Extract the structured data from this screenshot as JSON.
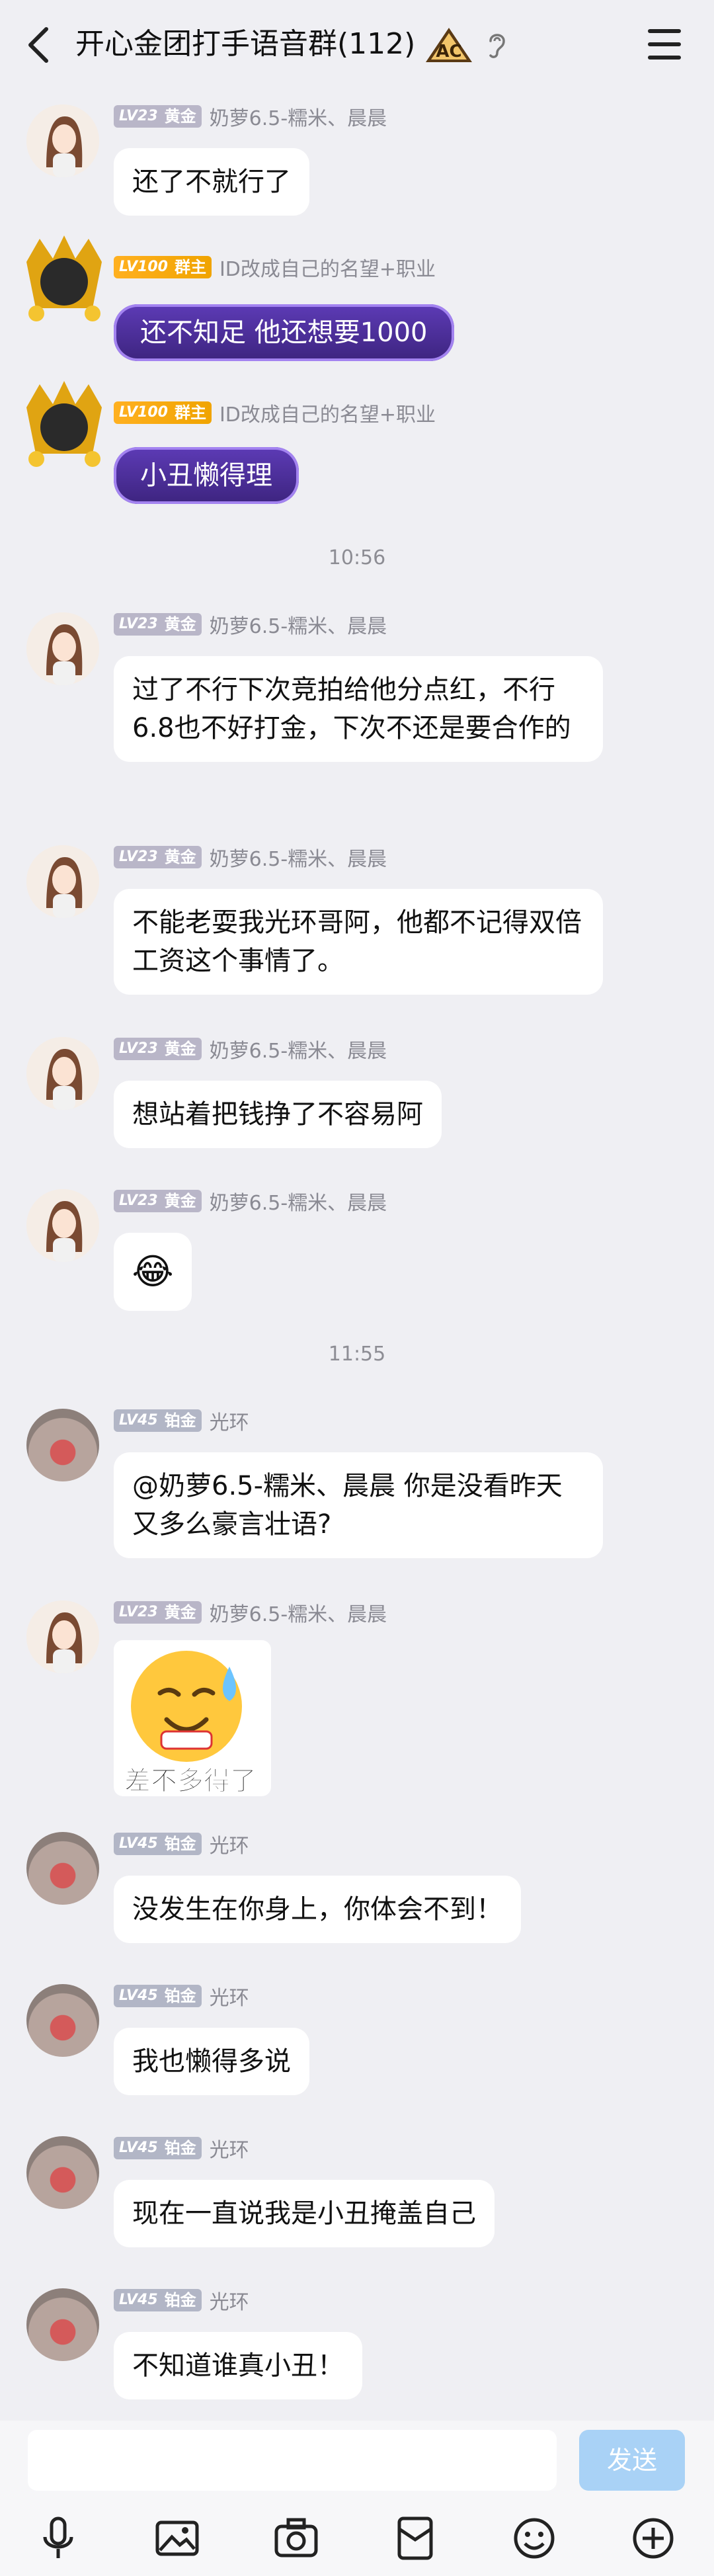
{
  "header": {
    "title": "开心金团打手语音群(112)",
    "badge_text": "AC"
  },
  "messages": [
    {
      "level": "LV23",
      "rank": "黄金",
      "nick": "奶萝6.5-糯米、晨晨",
      "text": "还了不就行了"
    },
    {
      "level": "LV100",
      "rank": "群主",
      "nick": "ID改成自己的名望+职业",
      "text": "还不知足 他还想要1000"
    },
    {
      "level": "LV100",
      "rank": "群主",
      "nick": "ID改成自己的名望+职业",
      "text": "小丑懒得理"
    },
    {
      "level": "LV23",
      "rank": "黄金",
      "nick": "奶萝6.5-糯米、晨晨",
      "text": "过了不行下次竞拍给他分点红，不行6.8也不好打金，下次不还是要合作的"
    },
    {
      "level": "LV23",
      "rank": "黄金",
      "nick": "奶萝6.5-糯米、晨晨",
      "text": "不能老耍我光环哥阿，他都不记得双倍工资这个事情了。"
    },
    {
      "level": "LV23",
      "rank": "黄金",
      "nick": "奶萝6.5-糯米、晨晨",
      "text": "想站着把钱挣了不容易阿"
    },
    {
      "level": "LV23",
      "rank": "黄金",
      "nick": "奶萝6.5-糯米、晨晨",
      "emoji": "😂"
    },
    {
      "level": "LV45",
      "rank": "铂金",
      "nick": "光环",
      "text": "@奶萝6.5-糯米、晨晨 你是没看昨天又多么豪言壮语?"
    },
    {
      "level": "LV23",
      "rank": "黄金",
      "nick": "奶萝6.5-糯米、晨晨",
      "sticker_caption": "差不多得了"
    },
    {
      "level": "LV45",
      "rank": "铂金",
      "nick": "光环",
      "text": "没发生在你身上，你体会不到！"
    },
    {
      "level": "LV45",
      "rank": "铂金",
      "nick": "光环",
      "text": "我也懒得多说"
    },
    {
      "level": "LV45",
      "rank": "铂金",
      "nick": "光环",
      "text": "现在一直说我是小丑掩盖自己"
    },
    {
      "level": "LV45",
      "rank": "铂金",
      "nick": "光环",
      "text": "不知道谁真小丑！"
    }
  ],
  "timestamps": [
    "10:56",
    "11:55"
  ],
  "input": {
    "placeholder": "",
    "send_label": "发送"
  },
  "toolbar": [
    "microphone-icon",
    "image-icon",
    "camera-icon",
    "red-packet-icon",
    "emoji-icon",
    "plus-icon"
  ],
  "colors": {
    "background": "#efeff3",
    "send_button": "#a9d2f6",
    "owner_badge": "#f0a400",
    "purple_bubble": "#4a2c99"
  }
}
